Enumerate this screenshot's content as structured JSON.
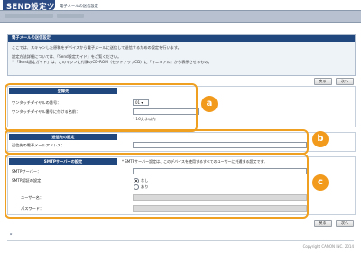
{
  "header": {
    "app_title": "SEND設定ツール",
    "subtitle": "電子メールの送信設定"
  },
  "buttons": {
    "back": "戻る",
    "next": "次へ"
  },
  "intro": {
    "title": "電子メールの送信設定",
    "line1": "ここでは、スキャンした原稿をデバイスから電子メールに送信して送信するための設定を行います。",
    "line2": "設定方法詳細については、「Send設定ガイド」をご覧ください。",
    "line3": "* 「Send設定ガイド」は、このマシンに付属のCD-ROM（セットアップCD）に「マニュアル」から表示させるもの。"
  },
  "register": {
    "title": "登録先",
    "onetouch_label": "ワンタッチダイヤルの番号：",
    "onetouch_value": "01",
    "name_label": "ワンタッチダイヤル番号に付ける名前：",
    "name_value": "",
    "name_hint": "* 16文字以内"
  },
  "destination": {
    "title": "送信先の設定",
    "email_label": "送信先の電子メールアドレス：",
    "email_value": ""
  },
  "smtp": {
    "title": "SMTPサーバーの設定",
    "note": "* SMTPサーバー設定は、このデバイスを使用するすべてのユーザーに共通する設定です。",
    "server_label": "SMTPサーバー：",
    "server_value": "",
    "auth_label": "SMTP認証の設定：",
    "auth_off": "なし",
    "auth_on": "あり",
    "user_label": "ユーザー名：",
    "pass_label": "パスワード："
  },
  "callouts": [
    "a",
    "b",
    "c"
  ],
  "footer": {
    "top_link": "⌅",
    "copyright": "Copyright CANON INC. 2014"
  }
}
